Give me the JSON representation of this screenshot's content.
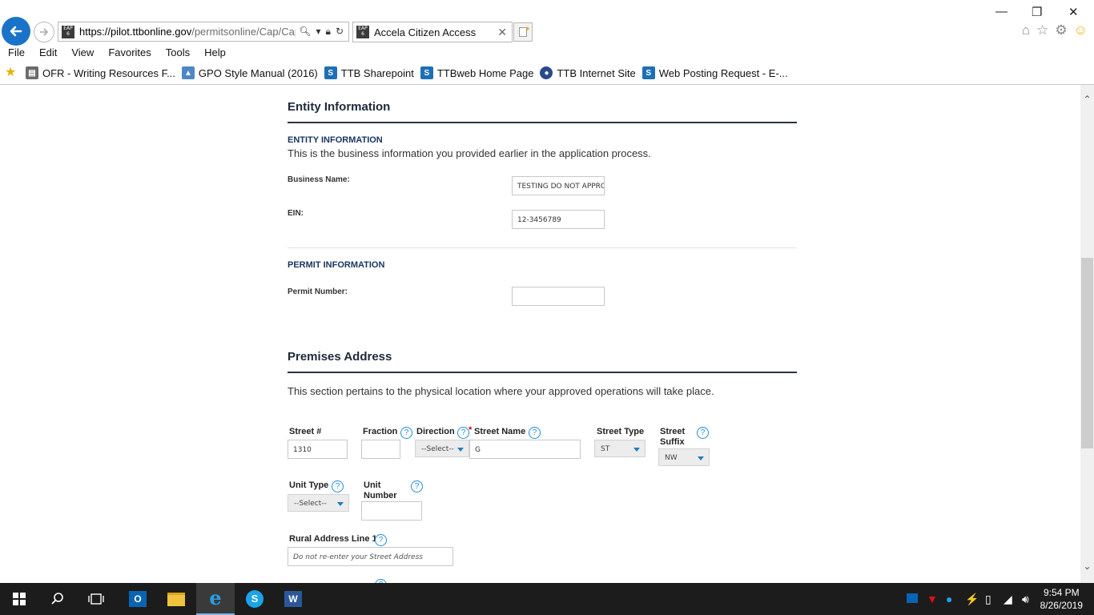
{
  "browser": {
    "url_host": "https://pilot.ttbonline.gov",
    "url_rest": "/permitsonline/Cap/Cap",
    "tab_title": "Accela Citizen Access",
    "badge": "EAP 6",
    "menu": [
      "File",
      "Edit",
      "View",
      "Favorites",
      "Tools",
      "Help"
    ],
    "favorites": [
      {
        "label": "OFR - Writing Resources F...",
        "color": "#6b6b6b"
      },
      {
        "label": "GPO Style Manual (2016)",
        "color": "#4f86c6"
      },
      {
        "label": "TTB Sharepoint",
        "color": "#1f6fb5"
      },
      {
        "label": "TTBweb Home Page",
        "color": "#1f6fb5"
      },
      {
        "label": "TTB Internet Site",
        "color": "#2a4a8a"
      },
      {
        "label": "Web Posting Request - E-...",
        "color": "#1f6fb5"
      }
    ]
  },
  "entity": {
    "title": "Entity Information",
    "subhead": "ENTITY INFORMATION",
    "desc": "This is the business information you provided earlier in the application process.",
    "business_name_label": "Business Name:",
    "business_name_value": "TESTING DO NOT APPROV",
    "ein_label": "EIN:",
    "ein_value": "12-3456789"
  },
  "permit": {
    "subhead": "PERMIT INFORMATION",
    "number_label": "Permit Number:",
    "number_value": ""
  },
  "premises": {
    "title": "Premises Address",
    "desc": "This section pertains to the physical location where your approved operations will take place.",
    "street_no_label": "Street #",
    "street_no_value": "1310",
    "fraction_label": "Fraction",
    "fraction_value": "",
    "direction_label": "Direction",
    "direction_value": "--Select--",
    "street_name_label": "Street Name",
    "street_name_value": "G",
    "street_type_label": "Street Type",
    "street_type_value": "ST",
    "street_suffix_label_1": "Street",
    "street_suffix_label_2": "Suffix",
    "street_suffix_value": "NW",
    "unit_type_label": "Unit Type",
    "unit_type_value": "--Select--",
    "unit_number_label_1": "Unit",
    "unit_number_label_2": "Number",
    "unit_number_value": "",
    "rural1_label": "Rural Address Line 1",
    "rural1_placeholder": "Do not re-enter your Street Address"
  },
  "taskbar": {
    "time": "9:54 PM",
    "date": "8/26/2019"
  }
}
